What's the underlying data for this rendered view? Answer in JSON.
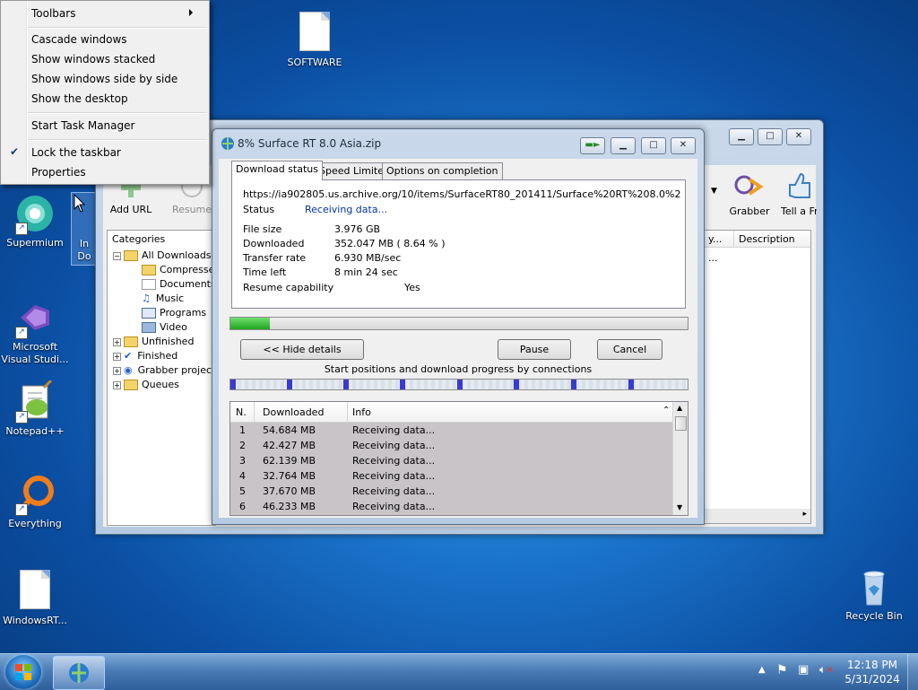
{
  "desktop": {
    "icons": [
      {
        "label": "SOFTWARE"
      },
      {
        "label": "Supermium"
      },
      {
        "label": "In Do"
      },
      {
        "label": "Microsoft Visual Studi..."
      },
      {
        "label": "Notepad++"
      },
      {
        "label": "Everything"
      },
      {
        "label": "WindowsRT..."
      },
      {
        "label": "Recycle Bin"
      }
    ]
  },
  "context_menu": {
    "items": [
      "Toolbars",
      "Cascade windows",
      "Show windows stacked",
      "Show windows side by side",
      "Show the desktop",
      "Start Task Manager",
      "Lock the taskbar",
      "Properties"
    ],
    "checkmark": "✔"
  },
  "idm": {
    "toolbar": {
      "add_url": "Add URL",
      "resume": "Resume",
      "grabber": "Grabber",
      "tell_friend": "Tell a Fri"
    },
    "categories_title": "Categories",
    "tree": [
      "All Downloads",
      "Compresse",
      "Documents",
      "Music",
      "Programs",
      "Video",
      "Unfinished",
      "Finished",
      "Grabber projec",
      "Queues"
    ],
    "list_headers": {
      "col1": "y...",
      "description": "Description"
    },
    "list_row_partial": "..."
  },
  "dialog": {
    "title": "8% Surface RT 8.0 Asia.zip",
    "tabs": [
      "Download status",
      "Speed Limiter",
      "Options on completion"
    ],
    "url": "https://ia902805.us.archive.org/10/items/SurfaceRT80_201411/Surface%20RT%208.0%20Asia.zip",
    "status_label": "Status",
    "status_value": "Receiving data...",
    "file_size_label": "File size",
    "file_size": "3.976  GB",
    "downloaded_label": "Downloaded",
    "downloaded": "352.047  MB  ( 8.64 % )",
    "transfer_rate_label": "Transfer rate",
    "transfer_rate": "6.930  MB/sec",
    "time_left_label": "Time left",
    "time_left": "8 min 24 sec",
    "resume_label": "Resume capability",
    "resume_value": "Yes",
    "progress_fraction": 0.0864,
    "hide_details": "<< Hide details",
    "pause": "Pause",
    "cancel": "Cancel",
    "connections_caption": "Start positions and download progress by connections",
    "table_headers": {
      "n": "N.",
      "downloaded": "Downloaded",
      "info": "Info"
    },
    "connections": [
      {
        "n": "1",
        "downloaded": "54.684  MB",
        "info": "Receiving data..."
      },
      {
        "n": "2",
        "downloaded": "42.427  MB",
        "info": "Receiving data..."
      },
      {
        "n": "3",
        "downloaded": "62.139  MB",
        "info": "Receiving data..."
      },
      {
        "n": "4",
        "downloaded": "32.764  MB",
        "info": "Receiving data..."
      },
      {
        "n": "5",
        "downloaded": "37.670  MB",
        "info": "Receiving data..."
      },
      {
        "n": "6",
        "downloaded": "46.233  MB",
        "info": "Receiving data..."
      }
    ]
  },
  "taskbar": {
    "time": "12:18 PM",
    "date": "5/31/2024"
  },
  "colors": {
    "accent": "#1a73c9",
    "progress": "#2db52d",
    "status_blue": "#0033a0"
  }
}
